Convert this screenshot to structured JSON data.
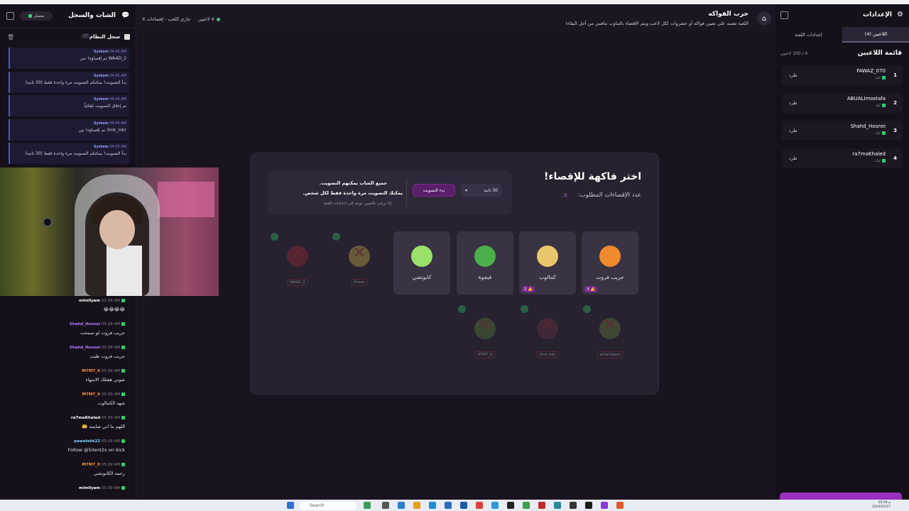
{
  "app": {
    "title": "حرب الفواكه",
    "description": "اللعبة تعتمد على تعيين فواكه أو خضروات لكل لاعب ويتم الإقصاء بالتناوب تنافس من أجل البقاء!",
    "players_count": "4 لاعبين",
    "game_status": "جاري اللعب - إقصاءات X"
  },
  "chat": {
    "title": "الشات والسجل",
    "connection": "متصل",
    "log_title": "سجل النظام",
    "log_count": "27",
    "logs": [
      {
        "sender": "System",
        "time": "04:42 AM",
        "text": "WAAD_2 تم إقصاؤه! نمر"
      },
      {
        "sender": "System",
        "time": "04:42 AM",
        "text": "بدأ التصويت! يمكنكم التصويت مرة واحدة فقط (30 ثانية)"
      },
      {
        "sender": "System",
        "time": "04:43 AM",
        "text": "تم إغلاق التصويت تلقائياً"
      },
      {
        "sender": "System",
        "time": "04:43 AM",
        "text": "3mk_mkr تم إقصاؤه! تين"
      },
      {
        "sender": "System",
        "time": "04:43 AM",
        "text": "بدأ التصويت! يمكنكم التصويت مرة واحدة فقط (30 ثانية)"
      }
    ],
    "messages": [
      {
        "user": "mlmllyam",
        "time": "05:08 AM",
        "text": "😂😂😂😂",
        "color": "#ffffff"
      },
      {
        "user": "Shahd_Hosnei",
        "time": "05:08 AM",
        "text": "جريب فروت لو سمحت",
        "color": "#b77bff"
      },
      {
        "user": "Shahd_Hosnei",
        "time": "05:08 AM",
        "text": "جريب فروت طيب",
        "color": "#b77bff"
      },
      {
        "user": "M7M7_X",
        "time": "05:09 AM",
        "text": "شوني هقتلك الاسهاء",
        "color": "#ff9a3c"
      },
      {
        "user": "M7M7_X",
        "time": "05:09 AM",
        "text": "شهد الكنتالوب",
        "color": "#ff9a3c"
      },
      {
        "user": "ra7maKhaled",
        "time": "05:09 AM",
        "text": "اللهم ما اني صايمه 🤲",
        "color": "#ffffff"
      },
      {
        "user": "pawelekk22",
        "time": "05:09 AM",
        "text": "Follow @5ilent2x on kick",
        "color": "#7fd4ff"
      },
      {
        "user": "M7M7_X",
        "time": "05:09 AM",
        "text": "رحمه الكابوتشي",
        "color": "#ff9a3c"
      },
      {
        "user": "mlmllyam",
        "time": "05:09 AM",
        "text": "",
        "color": "#ffffff"
      }
    ]
  },
  "modal": {
    "title": "اختر فاكهة للإقصاء!",
    "elim_label": "عدد الإقصاءات المطلوب:",
    "elim_value": "X",
    "vote_note1": "جميع الشات يمكنهم التصويت.",
    "vote_note2": "يمكنك التصويت مرة واحدة فقط لكل شخص.",
    "vote_note3": "إذا ترغب بالتغيير، توجه إلى إعدادات اللعبة",
    "start_vote": "بدء التصويت",
    "seconds": "30 ثانية",
    "fruits": [
      {
        "name": "جريب فروت",
        "votes": "3",
        "color": "#f08a2a"
      },
      {
        "name": "كنتالوب",
        "votes": "2",
        "color": "#e8c76a"
      },
      {
        "name": "فيجوة",
        "votes": "",
        "color": "#4bb04b"
      },
      {
        "name": "كابوتشي",
        "votes": "",
        "color": "#9be06a"
      }
    ],
    "eliminated": [
      {
        "tag": "Ansan",
        "color": "#d8c04a"
      },
      {
        "tag": "WAAD_2",
        "color": "#a82a3a"
      },
      {
        "tag": "ahsanqaam",
        "color": "#6a8a3a"
      },
      {
        "tag": "3mk_mkr",
        "color": "#6a3a4a"
      },
      {
        "tag": "M7M7_X",
        "color": "#5a8a3a"
      }
    ]
  },
  "settings": {
    "title": "الإعدادات",
    "tab_players": "اللاعبين (4)",
    "tab_game": "إعدادات اللعبة",
    "list_title": "قائمة اللاعبين",
    "list_count": "4 / 100 لاعبين",
    "kick": "طرد",
    "player_sub": "كيك",
    "players": [
      {
        "num": "1",
        "name": "FAWAZ_070"
      },
      {
        "num": "2",
        "name": "ABUALImostafa"
      },
      {
        "num": "3",
        "name": "Shahd_Hosnei"
      },
      {
        "num": "4",
        "name": "ra7maKhaled"
      }
    ]
  },
  "taskbar": {
    "search": "Search",
    "time": "م 05:09",
    "date": "2024/03/27"
  }
}
